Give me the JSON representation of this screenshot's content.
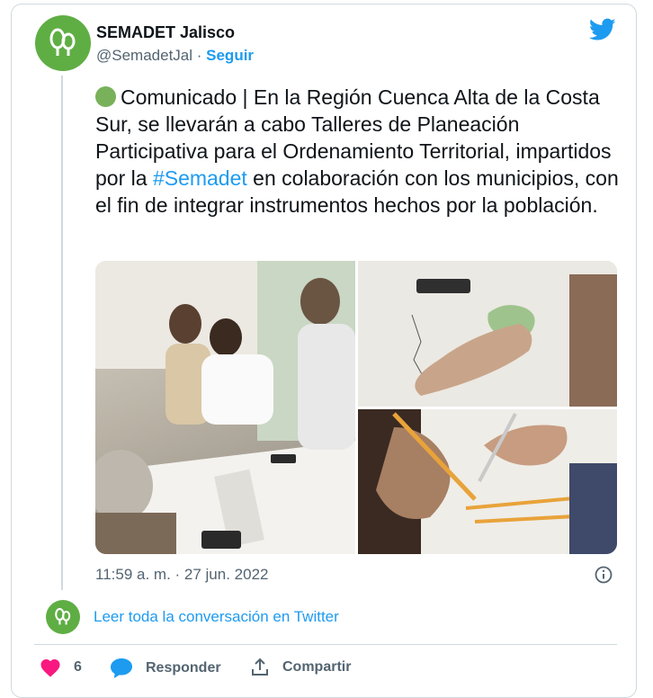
{
  "tweet": {
    "author_name": "SEMADET Jalisco",
    "handle": "@SemadetJal",
    "separator": " · ",
    "follow_label": "Seguir",
    "text_before_hashtag": "Comunicado | En la Región Cuenca Alta de la Costa Sur, se llevarán a cabo Talleres de Planeación Participativa para el Ordenamiento Territorial, impartidos por la ",
    "hashtag": "#Semadet",
    "text_after_hashtag": " en colaboración con los municipios, con el fin de integrar instrumentos hechos por la población.",
    "timestamp": "11:59 a. m. · 27 jun. 2022"
  },
  "thread": {
    "read_more_label": "Leer toda la conversación en Twitter"
  },
  "actions": {
    "like_count": "6",
    "reply_label": "Responder",
    "share_label": "Compartir"
  },
  "icons": {
    "brand": "twitter-bird-icon",
    "info": "info-icon",
    "like": "heart-icon",
    "reply": "speech-bubble-icon",
    "share": "share-icon",
    "status_emoji": "green-circle"
  },
  "colors": {
    "accent": "#1d9bf0",
    "avatar_green": "#5fae44",
    "like_red": "#f91880",
    "text": "#0f1419",
    "muted": "#536471",
    "border": "#cfd9de"
  }
}
